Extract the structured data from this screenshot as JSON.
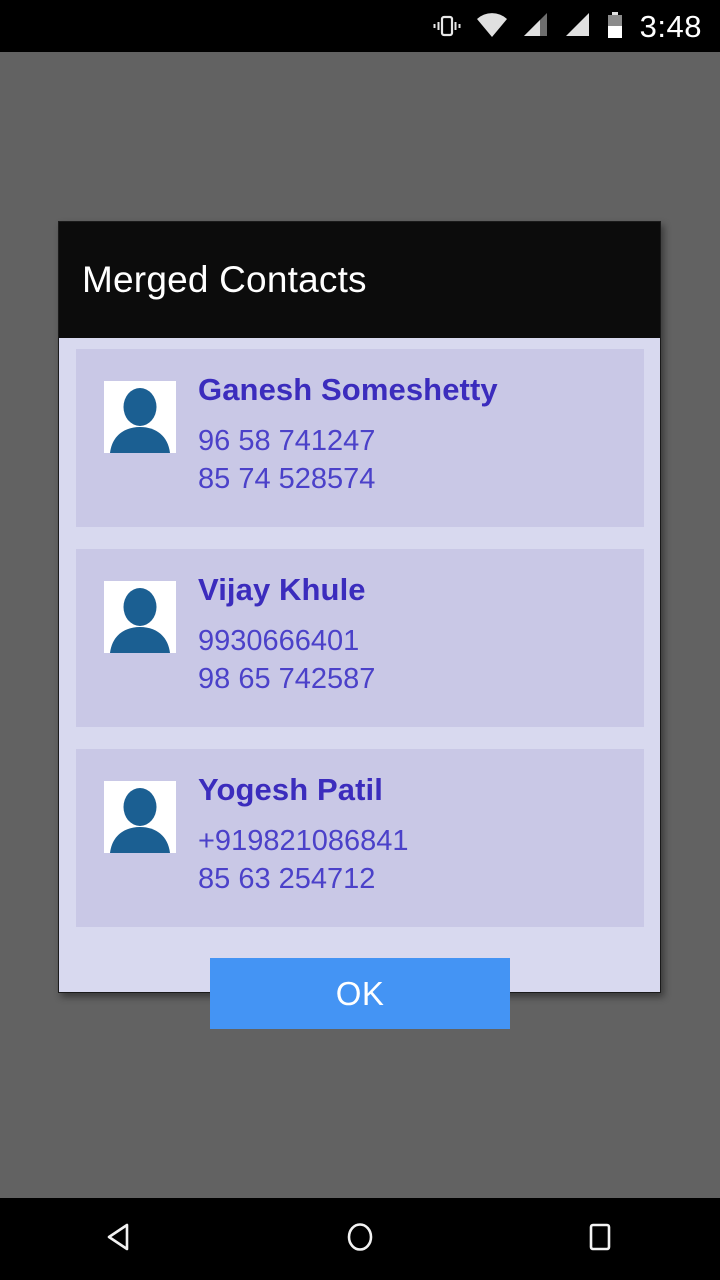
{
  "status_bar": {
    "time": "3:48",
    "icons": [
      {
        "name": "vibrate-icon",
        "label": "vibrate"
      },
      {
        "name": "wifi-icon",
        "label": "wifi"
      },
      {
        "name": "signal-sim1-icon",
        "label": "signal"
      },
      {
        "name": "signal-sim2-icon",
        "label": "signal"
      },
      {
        "name": "battery-icon",
        "label": "battery"
      }
    ]
  },
  "dialog": {
    "title": "Merged Contacts",
    "contacts": [
      {
        "name": "Ganesh Someshetty",
        "phone1": "96 58 741247",
        "phone2": "85 74 528574",
        "avatar": "person-avatar-icon"
      },
      {
        "name": "Vijay Khule",
        "phone1": "9930666401",
        "phone2": "98 65 742587",
        "avatar": "person-avatar-icon"
      },
      {
        "name": "Yogesh Patil",
        "phone1": "+919821086841",
        "phone2": "85 63 254712",
        "avatar": "person-avatar-icon"
      }
    ],
    "ok_label": "OK"
  },
  "nav_bar": {
    "back": "back-icon",
    "home": "home-icon",
    "recents": "recents-icon"
  },
  "colors": {
    "scrim": "#626262",
    "dialog_bg": "#d8d9ef",
    "row_bg": "#c9c8e6",
    "title_bar": "#0c0c0c",
    "name_text": "#3b2cbd",
    "phone_text": "#4b41c9",
    "ok_button": "#4494f4",
    "avatar_silhouette": "#1b5f92"
  }
}
